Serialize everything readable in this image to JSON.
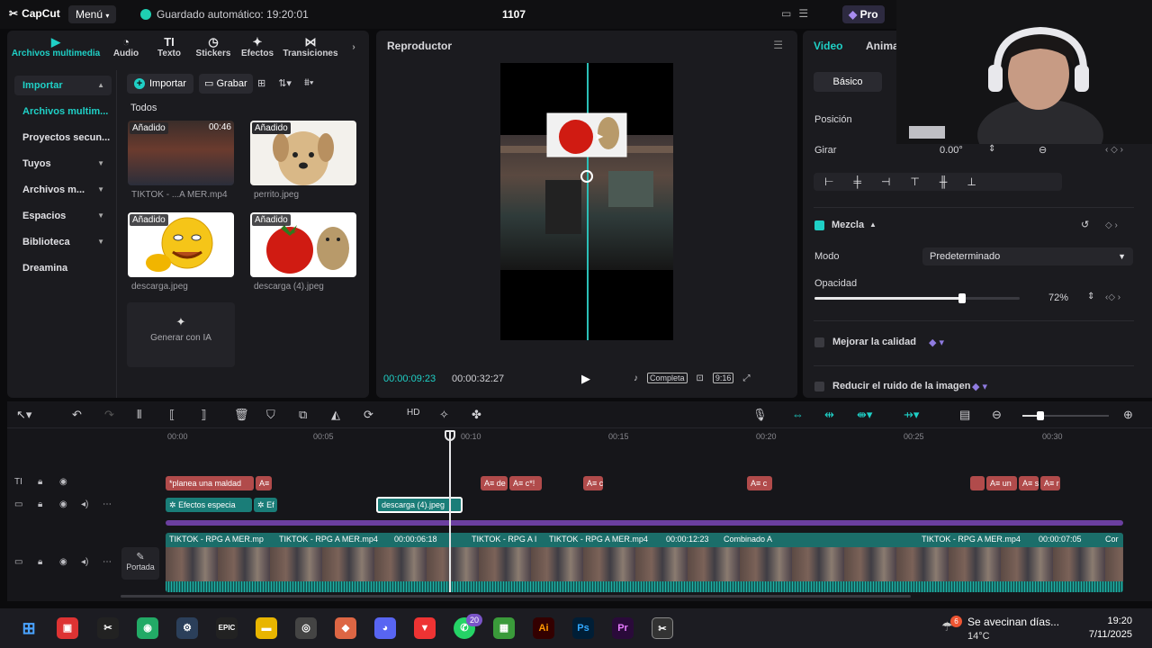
{
  "titlebar": {
    "app_name": "CapCut",
    "menu_label": "Menú",
    "autosave": "Guardado automático: 19:20:01",
    "project_title": "1107",
    "pro_label": "Pro"
  },
  "media_tabs": [
    {
      "label": "Archivos multimedia",
      "icon": "media-icon"
    },
    {
      "label": "Audio",
      "icon": "audio-icon"
    },
    {
      "label": "Texto",
      "icon": "text-icon"
    },
    {
      "label": "Stickers",
      "icon": "sticker-icon"
    },
    {
      "label": "Efectos",
      "icon": "effects-icon"
    },
    {
      "label": "Transiciones",
      "icon": "transitions-icon"
    }
  ],
  "sidebar": {
    "items": [
      {
        "label": "Importar"
      },
      {
        "label": "Archivos multim..."
      },
      {
        "label": "Proyectos secun..."
      },
      {
        "label": "Tuyos"
      },
      {
        "label": "Archivos m..."
      },
      {
        "label": "Espacios"
      },
      {
        "label": "Biblioteca"
      },
      {
        "label": "Dreamina"
      }
    ]
  },
  "media": {
    "import_label": "Importar",
    "record_label": "Grabar",
    "all_label": "Todos",
    "items": [
      {
        "badge": "Añadido",
        "duration": "00:46",
        "caption": "TIKTOK - ...A MER.mp4"
      },
      {
        "badge": "Añadido",
        "caption": "perrito.jpeg"
      },
      {
        "badge": "Añadido",
        "caption": "descarga.jpeg"
      },
      {
        "badge": "Añadido",
        "caption": "descarga (4).jpeg"
      }
    ],
    "generate_ai_label": "Generar con IA"
  },
  "player": {
    "title": "Reproductor",
    "current_time": "00:00:09:23",
    "total_time": "00:00:32:27",
    "full_label": "Completa",
    "ratio_label": "9:16"
  },
  "properties": {
    "tabs": [
      "Video",
      "Anima"
    ],
    "basic_label": "Básico",
    "position_label": "Posición",
    "rotate_label": "Girar",
    "rotate_value": "0.00°",
    "blend_label": "Mezcla",
    "mode_label": "Modo",
    "mode_value": "Predeterminado",
    "opacity_label": "Opacidad",
    "opacity_value": "72%",
    "opacity_fraction": 0.72,
    "enhance_label": "Mejorar la calidad",
    "denoise_label": "Reducir el ruido de la imagen"
  },
  "timeline": {
    "ruler": [
      "00:00",
      "00:05",
      "00:10",
      "00:15",
      "00:20",
      "00:25",
      "00:30"
    ],
    "text_clips": [
      "*planea una maldad",
      "A≡",
      "A≡ de",
      "A≡ c*!",
      "A≡ c",
      "A≡ c",
      "A≡ un",
      "A≡ s",
      "A≡ r"
    ],
    "effect_clips": [
      "Efectos especia",
      "Ef"
    ],
    "selected_clip": "descarga (4).jpeg",
    "video_segments": [
      {
        "label": "TIKTOK - RPG A MER.mp"
      },
      {
        "label": "TIKTOK - RPG A MER.mp4"
      },
      {
        "label": "00:00:06:18"
      },
      {
        "label": "TIKTOK - RPG A I"
      },
      {
        "label": "TIKTOK - RPG A MER.mp4"
      },
      {
        "label": "00:00:12:23"
      },
      {
        "label": "Combinado A"
      },
      {
        "label": "TIKTOK - RPG A MER.mp4"
      },
      {
        "label": "00:00:07:05"
      },
      {
        "label": "Cor"
      }
    ],
    "cover_label": "Portada"
  },
  "taskbar": {
    "whatsapp_badge": "20",
    "weather_badge": "6",
    "weather_title": "Se avecinan días...",
    "weather_temp": "14°C",
    "time": "19:20",
    "date": "7/11/2025"
  },
  "colors": {
    "accent": "#1fd0c6",
    "text_clip": "#b14b4b",
    "video_track": "#1b6e6a"
  }
}
